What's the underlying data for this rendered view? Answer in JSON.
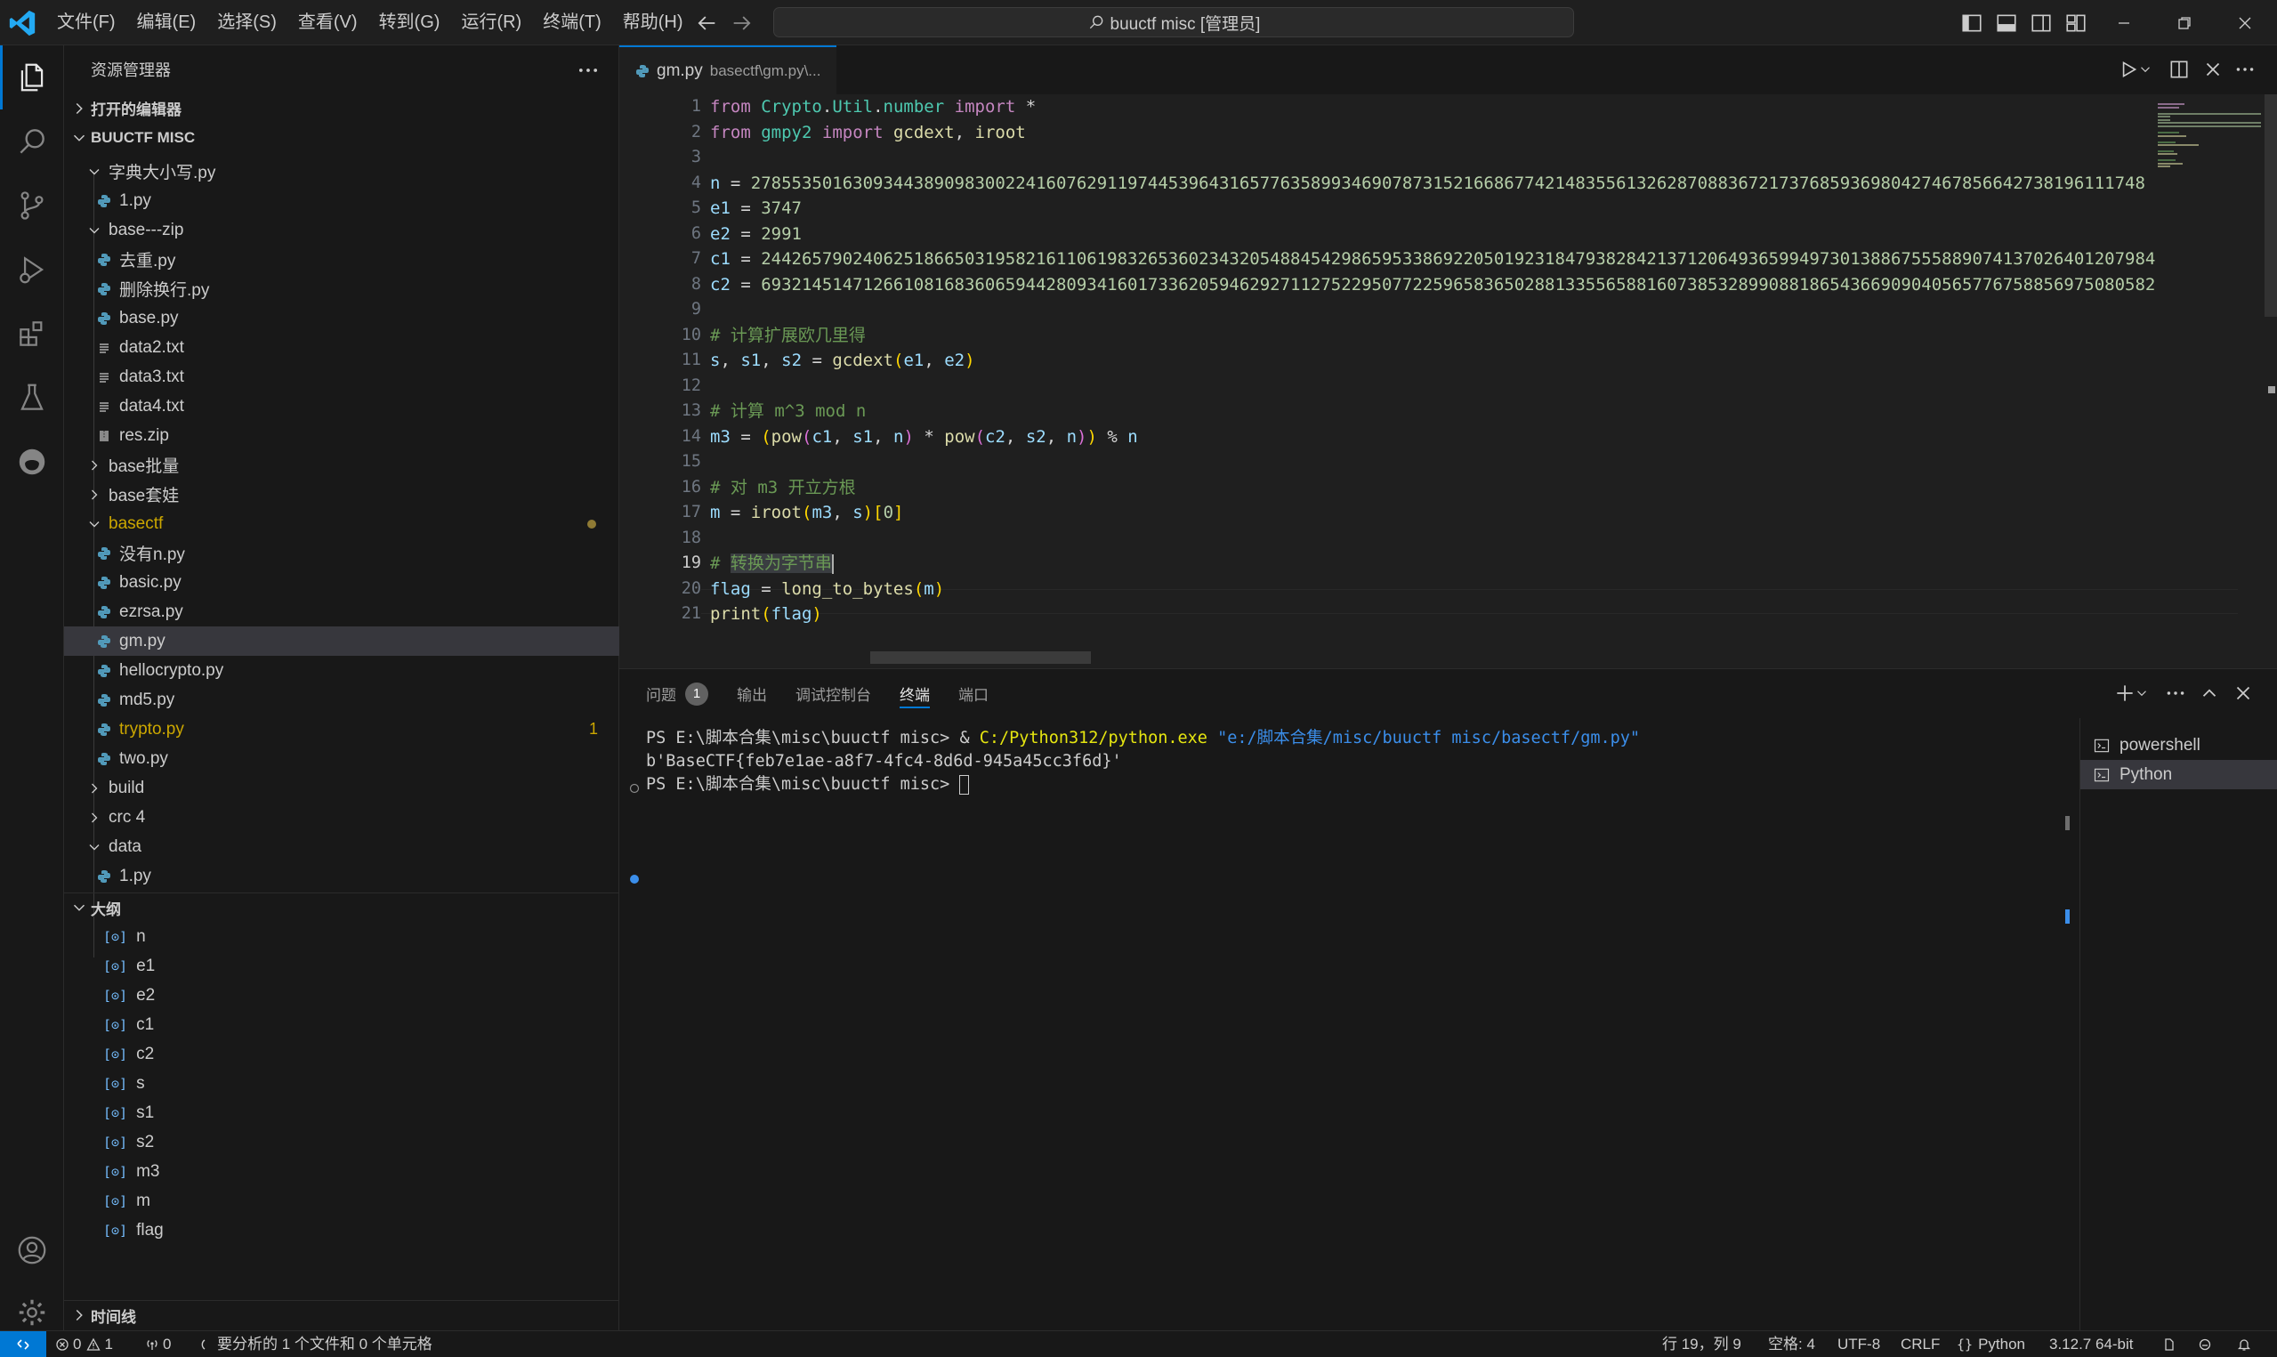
{
  "titlebar": {
    "menus": [
      "文件(F)",
      "编辑(E)",
      "选择(S)",
      "查看(V)",
      "转到(G)",
      "运行(R)",
      "终端(T)",
      "帮助(H)"
    ],
    "search_text": "buuctf misc [管理员]"
  },
  "sidebar": {
    "title": "资源管理器",
    "open_editors": "打开的编辑器",
    "workspace": "BUUCTF MISC",
    "tree": [
      {
        "label": "字典大小写.py",
        "type": "folder",
        "open": true
      },
      {
        "label": "1.py",
        "type": "py"
      },
      {
        "label": "base---zip",
        "type": "folder",
        "open": true
      },
      {
        "label": "去重.py",
        "type": "py"
      },
      {
        "label": "删除换行.py",
        "type": "py"
      },
      {
        "label": "base.py",
        "type": "py"
      },
      {
        "label": "data2.txt",
        "type": "txt"
      },
      {
        "label": "data3.txt",
        "type": "txt"
      },
      {
        "label": "data4.txt",
        "type": "txt"
      },
      {
        "label": "res.zip",
        "type": "zip"
      },
      {
        "label": "base批量",
        "type": "folder",
        "open": false
      },
      {
        "label": "base套娃",
        "type": "folder",
        "open": false
      },
      {
        "label": "basectf",
        "type": "folder",
        "open": true
      },
      {
        "label": "没有n.py",
        "type": "py"
      },
      {
        "label": "basic.py",
        "type": "py"
      },
      {
        "label": "ezrsa.py",
        "type": "py"
      },
      {
        "label": "gm.py",
        "type": "py"
      },
      {
        "label": "hellocrypto.py",
        "type": "py"
      },
      {
        "label": "md5.py",
        "type": "py"
      },
      {
        "label": "trypto.py",
        "type": "py"
      },
      {
        "label": "two.py",
        "type": "py"
      },
      {
        "label": "build",
        "type": "folder",
        "open": false
      },
      {
        "label": "crc 4",
        "type": "folder",
        "open": false
      },
      {
        "label": "data",
        "type": "folder",
        "open": true
      },
      {
        "label": "1.py",
        "type": "py"
      }
    ],
    "trypto_badge": "1",
    "outline_title": "大纲",
    "outline": [
      "n",
      "e1",
      "e2",
      "c1",
      "c2",
      "s",
      "s1",
      "s2",
      "m3",
      "m",
      "flag"
    ],
    "timeline_title": "时间线"
  },
  "editor": {
    "tab_name": "gm.py",
    "tab_path": "basectf\\gm.py\\...",
    "line_numbers": [
      "1",
      "2",
      "3",
      "4",
      "5",
      "6",
      "7",
      "8",
      "9",
      "10",
      "11",
      "12",
      "13",
      "14",
      "15",
      "16",
      "17",
      "18",
      "19",
      "20",
      "21"
    ],
    "code": {
      "l4_val": "27855350163093443890983002241607629119744539643165776358993469078731521668677421483556132628708836721737685936980427467856642738196111748",
      "l5_val": "3747",
      "l6_val": "2991",
      "l7_val": "24426579024062518665031958216110619832653602343205488454298659533869220501923184793828421371206493659949730138867555889074137026401207984",
      "l8_val": "69321451471266108168360659442809341601733620594629271127522950772259658365028813355658816073853289908818654366909040565776758856975080582",
      "c10": "# 计算扩展欧几里得",
      "c13": "# 计算 m^3 mod n",
      "c16": "# 对 m3 开立方根",
      "c19_hash": "# ",
      "c19_text": "转换为字节串"
    }
  },
  "panel": {
    "tabs": [
      "问题",
      "输出",
      "调试控制台",
      "终端",
      "端口"
    ],
    "problems_count": "1",
    "terminal": {
      "line1_prompt": "PS E:\\脚本合集\\misc\\buuctf misc> & ",
      "line1_exe": "C:/Python312/python.exe",
      "line1_arg": "\"e:/脚本合集/misc/buuctf misc/basectf/gm.py\"",
      "line2": "b'BaseCTF{feb7e1ae-a8f7-4fc4-8d6d-945a45cc3f6d}'",
      "line3_prompt": "PS E:\\脚本合集\\misc\\buuctf misc> "
    },
    "terminals": [
      "powershell",
      "Python"
    ]
  },
  "statusbar": {
    "errors": "0",
    "warnings": "1",
    "ports": "0",
    "analysis": "要分析的 1 个文件和 0 个单元格",
    "position": "行 19，列 9",
    "spaces": "空格: 4",
    "encoding": "UTF-8",
    "eol": "CRLF",
    "language": "Python",
    "interpreter": "3.12.7 64-bit"
  },
  "colors": {
    "accent": "#0078d4",
    "keyword": "#c586c0",
    "comment": "#6a9955",
    "number": "#b5cea8",
    "warning": "#cca700"
  }
}
